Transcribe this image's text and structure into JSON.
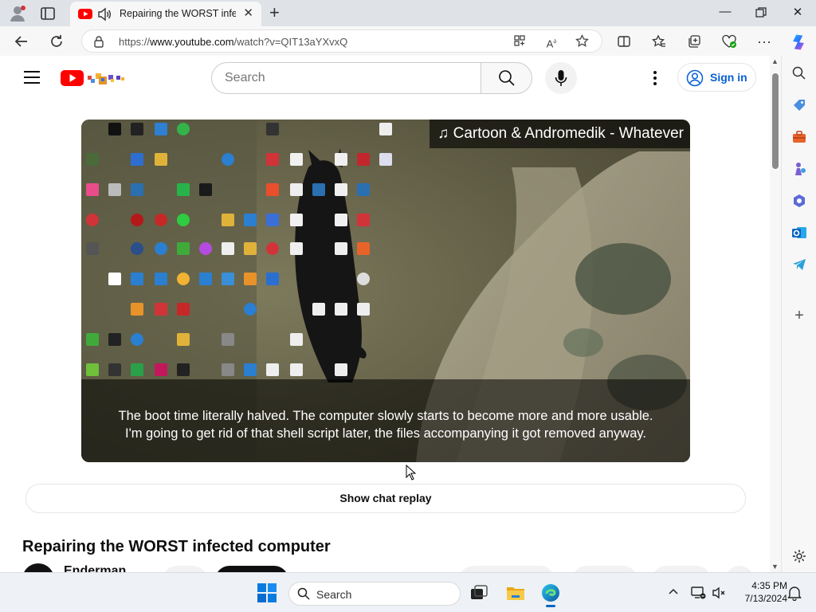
{
  "browser": {
    "tab_title": "Repairing the WORST infected computer",
    "url_prefix": "https://",
    "url_host": "www.youtube.com",
    "url_path": "/watch?v=QIT13aYXvxQ"
  },
  "header": {
    "search_placeholder": "Search",
    "signin_label": "Sign in"
  },
  "video": {
    "music_banner": "♫ Cartoon & Andromedik - Whatever",
    "caption_line1": "The boot time literally halved. The computer slowly starts to become more and more usable.",
    "caption_line2": "I'm going to get rid of that shell script later, the files accompanying it got removed anyway."
  },
  "page": {
    "chat_replay_label": "Show chat replay",
    "video_title": "Repairing the WORST infected computer",
    "channel_name": "Enderman"
  },
  "taskbar": {
    "search_label": "Search",
    "time": "4:35 PM",
    "date": "7/13/2024"
  },
  "colors": {
    "youtube_red": "#ff0000",
    "link_blue": "#065fd4",
    "edge_blue": "#0c59a4"
  },
  "icons": [
    "profile-icon",
    "tab-actions-icon",
    "youtube-favicon",
    "audio-icon",
    "close-icon",
    "plus-icon",
    "minimize-icon",
    "restore-icon",
    "back-icon",
    "refresh-icon",
    "lock-icon",
    "app-available-icon",
    "read-aloud-icon",
    "favorite-star-icon",
    "split-screen-icon",
    "favorites-icon",
    "collections-icon",
    "browser-essentials-icon",
    "more-icon",
    "copilot-icon",
    "hamburger-icon",
    "search-icon",
    "mic-icon",
    "account-icon",
    "cursor-icon",
    "windows-start-icon",
    "task-view-icon",
    "file-explorer-icon",
    "edge-icon",
    "chevron-up-icon",
    "network-icon",
    "volume-icon",
    "notification-bell-icon"
  ]
}
